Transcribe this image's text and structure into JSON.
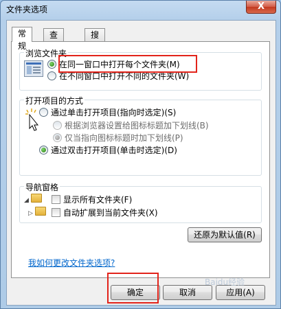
{
  "window": {
    "title": "文件夹选项",
    "close_label": "X"
  },
  "tabs": [
    {
      "label": "常规",
      "active": true
    },
    {
      "label": "查看",
      "active": false
    },
    {
      "label": "搜索",
      "active": false
    }
  ],
  "browse": {
    "heading": "浏览文件夹",
    "options": [
      {
        "label": "在同一窗口中打开每个文件夹(M)",
        "selected": true
      },
      {
        "label": "在不同窗口中打开不同的文件夹(W)",
        "selected": false
      }
    ]
  },
  "click": {
    "heading": "打开项目的方式",
    "single": "通过单击打开项目(指向时选定)(S)",
    "sub1": "根据浏览器设置给图标标题加下划线(B)",
    "sub2": "仅当指向图标标题时加下划线(P)",
    "double": "通过双击打开项目(单击时选定)(D)"
  },
  "nav": {
    "heading": "导航窗格",
    "show_all": "显示所有文件夹(F)",
    "auto_expand": "自动扩展到当前文件夹(X)"
  },
  "restore_label": "还原为默认值(R)",
  "help_link": "我如何更改文件夹选项?",
  "footer": {
    "ok": "确定",
    "cancel": "取消",
    "apply": "应用(A)"
  },
  "watermark": "Baidu经验",
  "colors": {
    "highlight": "#e2231a",
    "link": "#0066cc"
  }
}
